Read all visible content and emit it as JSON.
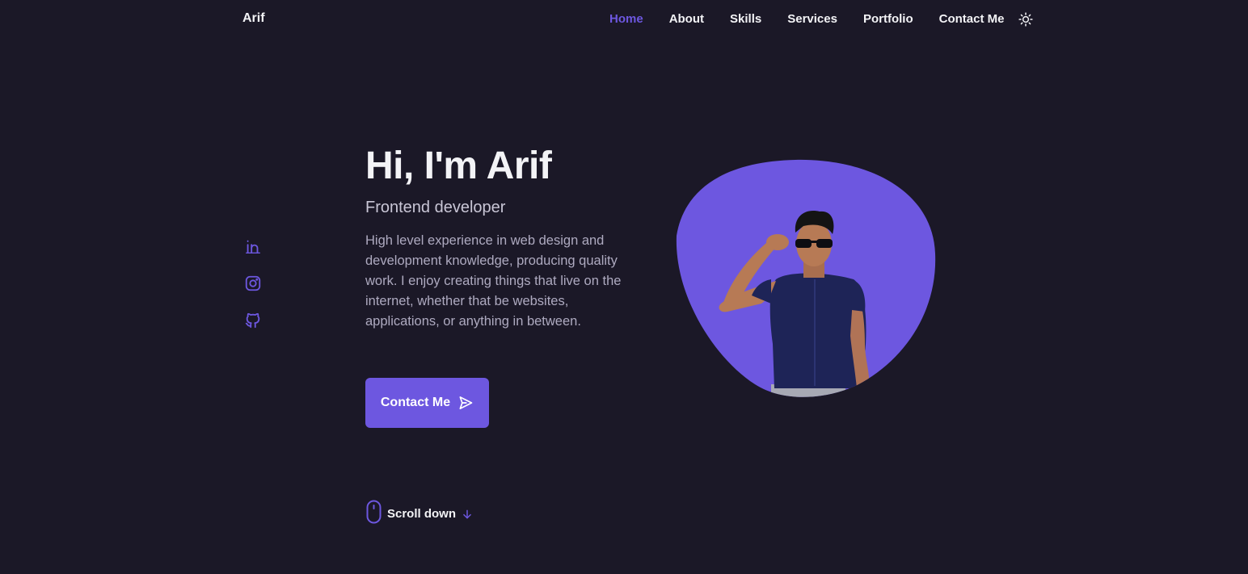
{
  "header": {
    "logo": "Arif",
    "nav": [
      {
        "label": "Home",
        "active": true
      },
      {
        "label": "About",
        "active": false
      },
      {
        "label": "Skills",
        "active": false
      },
      {
        "label": "Services",
        "active": false
      },
      {
        "label": "Portfolio",
        "active": false
      },
      {
        "label": "Contact Me",
        "active": false
      }
    ],
    "theme_icon": "sun-icon"
  },
  "social": [
    {
      "icon": "linkedin-icon"
    },
    {
      "icon": "instagram-icon"
    },
    {
      "icon": "github-icon"
    }
  ],
  "hero": {
    "title": "Hi, I'm Arif",
    "subtitle": "Frontend developer",
    "description": "High level experience in web design and development knowledge, producing quality work. I enjoy creating things that live on the internet, whether that be websites, applications, or anything in between.",
    "button_label": "Contact Me",
    "button_icon": "send-icon"
  },
  "scroll": {
    "label": "Scroll down",
    "icon": "mouse-icon",
    "arrow_icon": "arrow-down-icon"
  },
  "colors": {
    "background": "#1b1827",
    "accent": "#6d57e0",
    "text": "#f3f3f6",
    "muted": "#aeaac0"
  }
}
